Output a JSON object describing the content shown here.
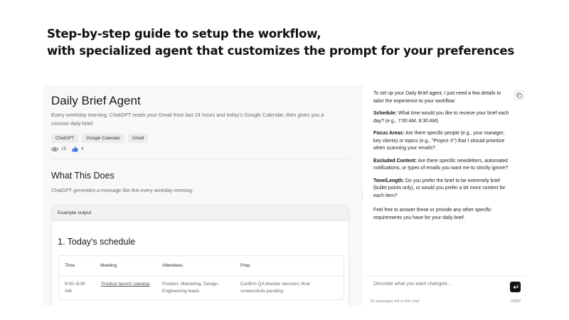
{
  "headline": {
    "line1": "Step-by-step guide to setup the workflow,",
    "line2": "with specialized agent that customizes the prompt for your preferences"
  },
  "agent": {
    "title": "Daily Brief Agent",
    "description": "Every weekday morning, ChatGPT reads your Gmail from last 24 hours and today's Google Calendar, then gives you a concise daily brief.",
    "tags": [
      "ChatGPT",
      "Google Calendar",
      "Gmail"
    ],
    "views": "15",
    "likes": "4"
  },
  "section": {
    "title": "What This Does",
    "description": "ChatGPT generates a message like this every workday morning:"
  },
  "example": {
    "header": "Example output",
    "heading": "1. Today's schedule",
    "columns": [
      "Time",
      "Meeting",
      "Attendees",
      "Prep"
    ],
    "rows": [
      [
        "9:00–9:30 AM",
        "Product launch standup",
        "Product, Marketing, Design, Engineering leads",
        "Confirm QA blocker decision; final screenshots pending"
      ]
    ]
  },
  "chat": {
    "intro": "To set up your Daily Brief agent, I just need a few details to tailor the experience to your workflow:",
    "questions": [
      {
        "label": "Schedule:",
        "text": " What time would you like to receive your brief each day? (e.g., 7:00 AM, 8:30 AM)"
      },
      {
        "label": "Focus Areas:",
        "text": " Are there specific people (e.g., your manager, key clients) or topics (e.g., \"Project X\") that I should prioritize when scanning your emails?"
      },
      {
        "label": "Excluded Content:",
        "text": " Are there specific newsletters, automated notifications, or types of emails you want me to strictly ignore?"
      },
      {
        "label": "Tone/Length:",
        "text": " Do you prefer the brief to be extremely brief (bullet points only), or would you prefer a bit more context for each item?"
      }
    ],
    "closing": "Feel free to answer these or provide any other specific requirements you have for your daily brief.",
    "input_placeholder": "Describe what you want changed...",
    "messages_left": "10 messages left in this chat",
    "char_count": "0/800"
  }
}
